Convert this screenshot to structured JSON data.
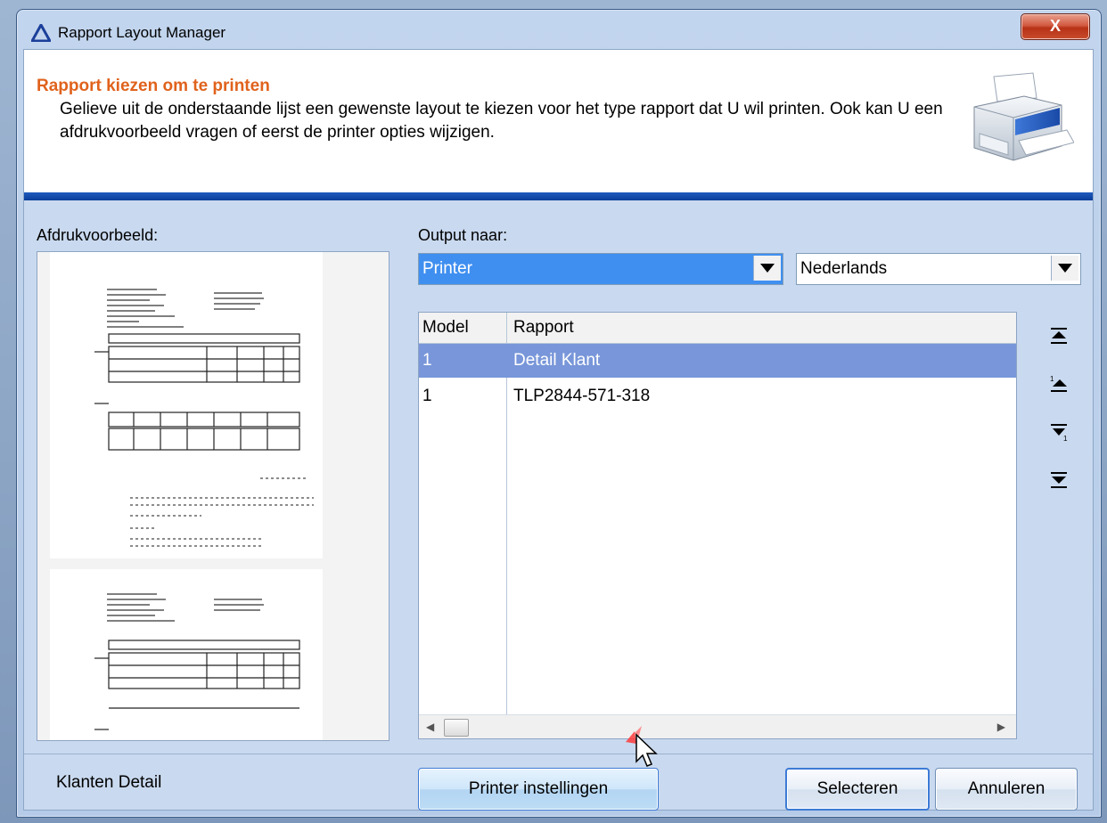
{
  "window": {
    "title": "Rapport Layout Manager",
    "close_label": "X"
  },
  "header": {
    "title": "Rapport kiezen om te printen",
    "description": "Gelieve uit de onderstaande lijst een gewenste layout te kiezen voor het type rapport dat U wil printen. Ook kan U een afdrukvoorbeeld vragen of eerst de printer opties wijzigen."
  },
  "preview": {
    "label": "Afdrukvoorbeeld:"
  },
  "output": {
    "label": "Output naar:",
    "target_value": "Printer",
    "language_value": "Nederlands"
  },
  "grid": {
    "columns": [
      "Model",
      "Rapport"
    ],
    "rows": [
      {
        "model": "1",
        "rapport": "Detail Klant",
        "selected": true
      },
      {
        "model": "1",
        "rapport": "TLP2844-571-318",
        "selected": false
      }
    ]
  },
  "side_buttons": [
    "move-to-top-icon",
    "move-up-icon",
    "move-down-icon",
    "move-to-bottom-icon"
  ],
  "footer": {
    "label": "Klanten Detail",
    "printer_settings_label": "Printer instellingen",
    "select_label": "Selecteren",
    "cancel_label": "Annuleren"
  },
  "colors": {
    "header_title": "#e0621c",
    "selection": "#7896d9",
    "rule": "#1f5bbd"
  }
}
